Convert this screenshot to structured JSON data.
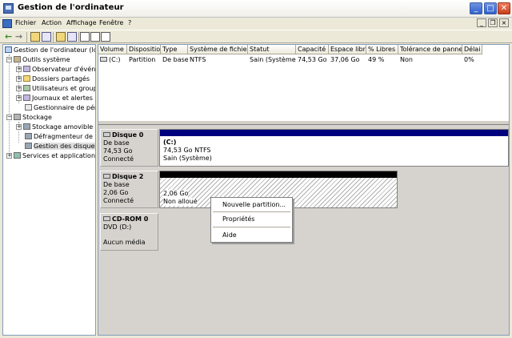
{
  "window": {
    "title": "Gestion de l'ordinateur"
  },
  "menu": {
    "items": [
      "Fichier",
      "Action",
      "Affichage",
      "Fenêtre",
      "?"
    ]
  },
  "tree": {
    "root": "Gestion de l'ordinateur (local)",
    "outils": "Outils système",
    "observateur": "Observateur d'événements",
    "dossiers": "Dossiers partagés",
    "utilisateurs": "Utilisateurs et groupes locaux",
    "journaux": "Journaux et alertes de performance",
    "peripheriques": "Gestionnaire de périphériques",
    "stockage": "Stockage",
    "amovible": "Stockage amovible",
    "defrag": "Défragmenteur de disque",
    "disques": "Gestion des disques",
    "services": "Services et applications"
  },
  "volume_table": {
    "headers": [
      "Volume",
      "Disposition",
      "Type",
      "Système de fichiers",
      "Statut",
      "Capacité",
      "Espace libre",
      "% Libres",
      "Tolérance de pannes",
      "Délai"
    ],
    "row": [
      "(C:)",
      "Partition",
      "De base",
      "NTFS",
      "Sain (Système)",
      "74,53 Go",
      "37,06 Go",
      "49 %",
      "Non",
      "0%"
    ]
  },
  "disks": {
    "disk0": {
      "name": "Disque 0",
      "type": "De base",
      "size": "74,53 Go",
      "status": "Connecté",
      "partition": {
        "label": "(C:)",
        "size_fs": "74,53 Go NTFS",
        "status": "Sain (Système)"
      }
    },
    "disk2": {
      "name": "Disque 2",
      "type": "De base",
      "size": "2,06 Go",
      "status": "Connecté",
      "partition": {
        "size": "2,06 Go",
        "status": "Non alloué"
      }
    },
    "cdrom": {
      "name": "CD-ROM 0",
      "type": "DVD (D:)",
      "media": "Aucun média"
    }
  },
  "context_menu": {
    "new_partition": "Nouvelle partition...",
    "properties": "Propriétés",
    "help": "Aide"
  },
  "colors": {
    "primary_partition": "#00007f",
    "unallocated": "#000000"
  }
}
